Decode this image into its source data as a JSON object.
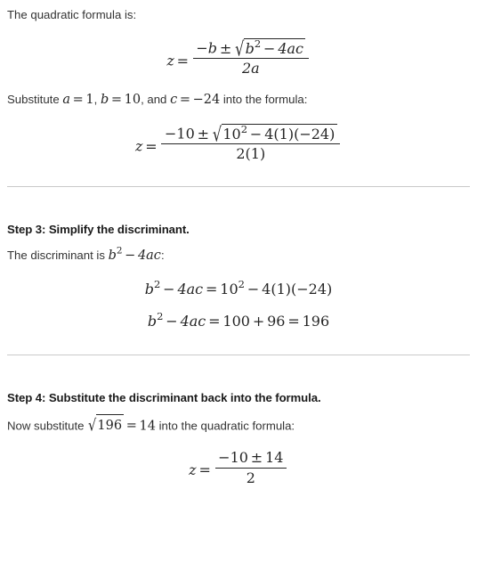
{
  "document": {
    "variable": "z",
    "divider_color": "#c9c9c9",
    "text_color": "#333333",
    "math_color": "#262626",
    "background": "#ffffff"
  },
  "intro": {
    "text": "The quadratic formula is:"
  },
  "formula_general": {
    "lhs": "z",
    "equals": "=",
    "numerator_lead": "−b ±",
    "radicand": "b² − 4ac",
    "denominator": "2a",
    "latex": "z = \\frac{-b \\pm \\sqrt{b^2 - 4ac}}{2a}",
    "parts": {
      "minus": "−",
      "b": "b",
      "pm": "±",
      "radical": "√",
      "b2_base": "b",
      "b2_exp": "2",
      "minus2": "−",
      "four_a_c": "4ac",
      "two_a": "2a"
    }
  },
  "substitute_line": {
    "lead": "Substitute",
    "a_label": "a",
    "a_eq": "=",
    "a_value": "1",
    "sep1": ",",
    "b_label": "b",
    "b_eq": "=",
    "b_value": "10",
    "sep2": ", and",
    "c_label": "c",
    "c_eq": "=",
    "c_value": "−24",
    "tail": "into the formula:",
    "full_text": "Substitute a = 1, b = 10, and c = −24 into the formula:"
  },
  "formula_substituted": {
    "lhs": "z",
    "equals": "=",
    "numerator_lead": "−10 ±",
    "radicand": "10² − 4(1)(−24)",
    "denominator": "2(1)",
    "latex": "z = \\frac{-10 \\pm \\sqrt{10^2 - 4(1)(-24)}}{2(1)}",
    "parts": {
      "minus": "−",
      "ten": "10",
      "pm": "±",
      "radical": "√",
      "ten_base": "10",
      "ten_exp": "2",
      "minus2": "−",
      "four": "4",
      "open1": "(",
      "one": "1",
      "close1": ")",
      "open2": "(",
      "neg24": "−24",
      "close2": ")",
      "den_two": "2",
      "den_open": "(",
      "den_one": "1",
      "den_close": ")"
    }
  },
  "step3": {
    "heading": "Step 3: Simplify the discriminant.",
    "lead_text_before": "The discriminant is",
    "lead_math_base": "b",
    "lead_math_exp": "2",
    "lead_math_minus": "−",
    "lead_math_tail": "4ac",
    "lead_text_after": ":",
    "lead_full": "The discriminant is b² − 4ac:",
    "equations": [
      {
        "latex": "b^2 - 4ac = 10^2 - 4(1)(-24)",
        "text": "b² − 4ac = 10² − 4(1)(−24)",
        "parts": {
          "b": "b",
          "b_exp": "2",
          "minus1": "−",
          "four_ac": "4ac",
          "eq": "=",
          "ten": "10",
          "ten_exp": "2",
          "minus2": "−",
          "four": "4",
          "o1": "(",
          "one": "1",
          "c1": ")",
          "o2": "(",
          "neg24": "−24",
          "c2": ")"
        }
      },
      {
        "latex": "b^2 - 4ac = 100 + 96 = 196",
        "text": "b² − 4ac = 100 + 96 = 196",
        "parts": {
          "b": "b",
          "b_exp": "2",
          "minus1": "−",
          "four_ac": "4ac",
          "eq1": "=",
          "v100": "100",
          "plus": "+",
          "v96": "96",
          "eq2": "=",
          "v196": "196"
        }
      }
    ]
  },
  "step4": {
    "heading": "Step 4: Substitute the discriminant back into the formula.",
    "lead_text_before": "Now substitute",
    "lead_radical": "√",
    "lead_radicand": "196",
    "lead_equals": "=",
    "lead_result": "14",
    "lead_text_after": "into the quadratic formula:",
    "lead_full": "Now substitute √196 = 14 into the quadratic formula:",
    "formula": {
      "lhs": "z",
      "equals": "=",
      "numerator": "−10 ± 14",
      "denominator": "2",
      "latex": "z = \\frac{-10 \\pm 14}{2}",
      "parts": {
        "minus": "−",
        "ten": "10",
        "pm": "±",
        "fourteen": "14",
        "den": "2"
      }
    }
  },
  "dividers": {
    "count": 2
  }
}
